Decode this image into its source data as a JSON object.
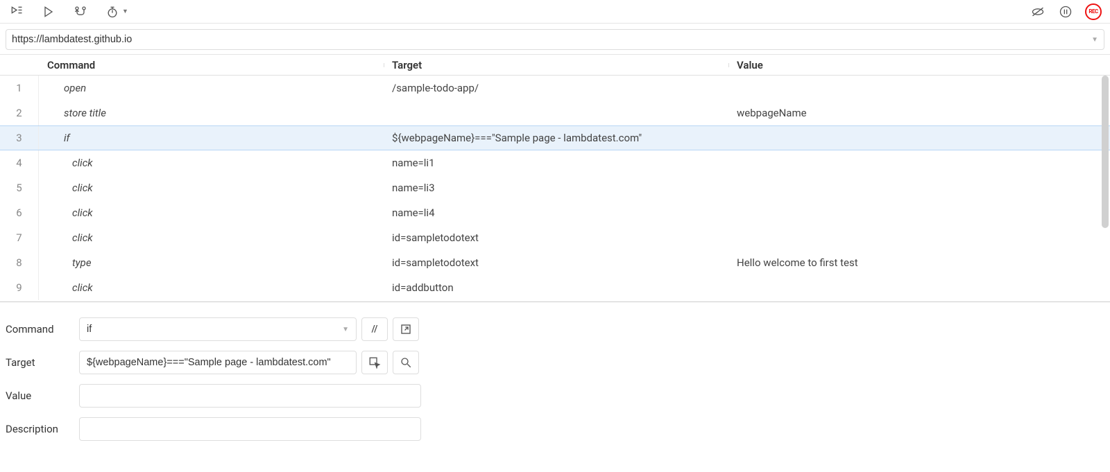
{
  "toolbar": {
    "url": "https://lambdatest.github.io",
    "rec_label": "REC"
  },
  "headers": {
    "command": "Command",
    "target": "Target",
    "value": "Value"
  },
  "rows": [
    {
      "n": "1",
      "cmd": "open",
      "indent": false,
      "target": "/sample-todo-app/",
      "value": ""
    },
    {
      "n": "2",
      "cmd": "store title",
      "indent": false,
      "target": "",
      "value": "webpageName"
    },
    {
      "n": "3",
      "cmd": "if",
      "indent": false,
      "target": "${webpageName}===\"Sample page - lambdatest.com\"",
      "value": "",
      "selected": true
    },
    {
      "n": "4",
      "cmd": "click",
      "indent": true,
      "target": "name=li1",
      "value": ""
    },
    {
      "n": "5",
      "cmd": "click",
      "indent": true,
      "target": "name=li3",
      "value": ""
    },
    {
      "n": "6",
      "cmd": "click",
      "indent": true,
      "target": "name=li4",
      "value": ""
    },
    {
      "n": "7",
      "cmd": "click",
      "indent": true,
      "target": "id=sampletodotext",
      "value": ""
    },
    {
      "n": "8",
      "cmd": "type",
      "indent": true,
      "target": "id=sampletodotext",
      "value": "Hello welcome to first test"
    },
    {
      "n": "9",
      "cmd": "click",
      "indent": true,
      "target": "id=addbutton",
      "value": ""
    }
  ],
  "editor": {
    "labels": {
      "command": "Command",
      "target": "Target",
      "value": "Value",
      "description": "Description"
    },
    "command_value": "if",
    "target_value": "${webpageName}===\"Sample page - lambdatest.com\"",
    "value_value": "",
    "description_value": "",
    "slash_label": "//"
  }
}
